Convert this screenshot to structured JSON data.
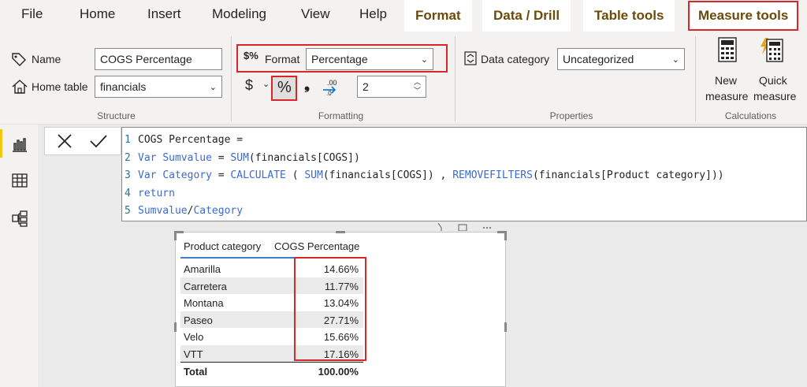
{
  "tabs": [
    {
      "label": "File",
      "kind": "normal"
    },
    {
      "label": "Home",
      "kind": "normal"
    },
    {
      "label": "Insert",
      "kind": "normal"
    },
    {
      "label": "Modeling",
      "kind": "normal"
    },
    {
      "label": "View",
      "kind": "normal"
    },
    {
      "label": "Help",
      "kind": "normal"
    },
    {
      "label": "Format",
      "kind": "contextual"
    },
    {
      "label": "Data / Drill",
      "kind": "contextual"
    },
    {
      "label": "Table tools",
      "kind": "contextual"
    },
    {
      "label": "Measure tools",
      "kind": "active"
    }
  ],
  "structure": {
    "group_label": "Structure",
    "name_label": "Name",
    "name_value": "COGS Percentage",
    "home_table_label": "Home table",
    "home_table_value": "financials"
  },
  "formatting": {
    "group_label": "Formatting",
    "format_label": "Format",
    "format_value": "Percentage",
    "currency_symbol": "$",
    "percent_symbol": "%",
    "comma_symbol": "ع",
    "decimals_value": "2"
  },
  "properties": {
    "group_label": "Properties",
    "data_category_label": "Data category",
    "data_category_value": "Uncategorized"
  },
  "calculations": {
    "group_label": "Calculations",
    "new_measure_line1": "New",
    "new_measure_line2": "measure",
    "quick_measure_line1": "Quick",
    "quick_measure_line2": "measure"
  },
  "formula": {
    "lines": [
      {
        "num": "1",
        "parts": [
          {
            "t": "COGS Percentage =",
            "c": "plain"
          }
        ]
      },
      {
        "num": "2",
        "parts": [
          {
            "t": "Var ",
            "c": "kw"
          },
          {
            "t": "Sumvalue",
            "c": "kw"
          },
          {
            "t": " = ",
            "c": "plain"
          },
          {
            "t": "SUM",
            "c": "fn"
          },
          {
            "t": "(financials[COGS])",
            "c": "plain"
          }
        ]
      },
      {
        "num": "3",
        "parts": [
          {
            "t": "Var ",
            "c": "kw"
          },
          {
            "t": "Category",
            "c": "kw"
          },
          {
            "t": " = ",
            "c": "plain"
          },
          {
            "t": "CALCULATE",
            "c": "fn"
          },
          {
            "t": " ( ",
            "c": "plain"
          },
          {
            "t": "SUM",
            "c": "fn"
          },
          {
            "t": "(financials[COGS]) , ",
            "c": "plain"
          },
          {
            "t": "REMOVEFILTERS",
            "c": "fn"
          },
          {
            "t": "(financials[Product category]))",
            "c": "plain"
          }
        ]
      },
      {
        "num": "4",
        "parts": [
          {
            "t": "return",
            "c": "kw"
          }
        ]
      },
      {
        "num": "5",
        "parts": [
          {
            "t": "Sumvalue",
            "c": "kw"
          },
          {
            "t": "/",
            "c": "plain"
          },
          {
            "t": "Category",
            "c": "kw"
          }
        ]
      }
    ]
  },
  "table": {
    "col1": "Product category",
    "col2": "COGS Percentage",
    "rows": [
      {
        "category": "Amarilla",
        "value": "14.66%"
      },
      {
        "category": "Carretera",
        "value": "11.77%"
      },
      {
        "category": "Montana",
        "value": "13.04%"
      },
      {
        "category": "Paseo",
        "value": "27.71%"
      },
      {
        "category": "Velo",
        "value": "15.66%"
      },
      {
        "category": "VTT",
        "value": "17.16%"
      }
    ],
    "total_label": "Total",
    "total_value": "100.00%"
  },
  "colors": {
    "accent_red": "#d62828",
    "ribbon_bg": "#f3f2f1",
    "contextual_tab_text": "#6b4a0c",
    "dax_keyword": "#3b6ad1"
  }
}
